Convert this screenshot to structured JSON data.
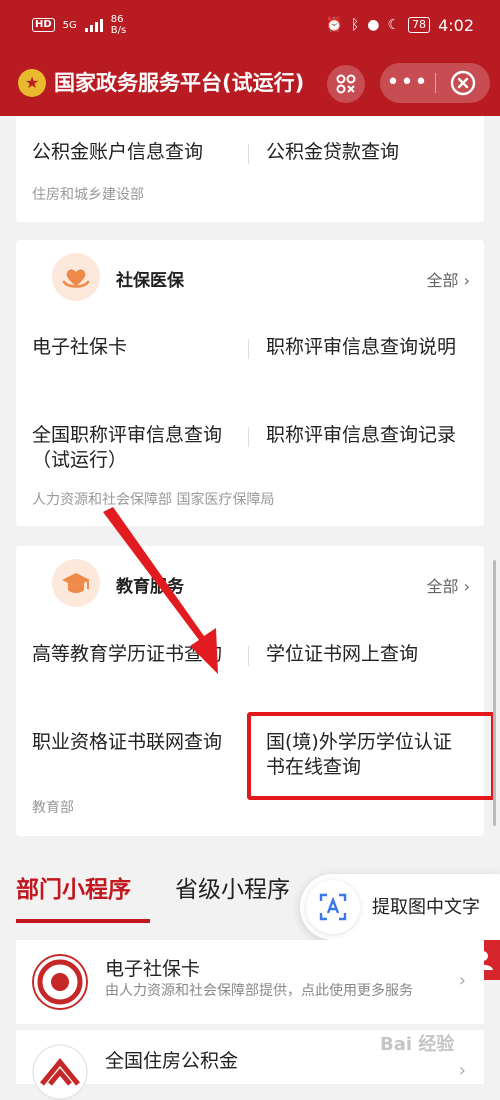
{
  "status_bar": {
    "hd": "HD",
    "net": "5G",
    "speed_value": "86",
    "speed_unit": "B/s",
    "battery": "78",
    "time": "4:02"
  },
  "header": {
    "title": "国家政务服务平台(试运行)",
    "more_icon": "ellipsis-icon",
    "close_icon": "close-circle-icon",
    "brand_color": "#b81c22"
  },
  "card_housing": {
    "items": [
      "公积金账户信息查询",
      "公积金贷款查询"
    ],
    "department": "住房和城乡建设部"
  },
  "card_social": {
    "title": "社保医保",
    "all_label": "全部",
    "items": [
      "电子社保卡",
      "职称评审信息查询说明",
      "全国职称评审信息查询（试运行）",
      "职称评审信息查询记录"
    ],
    "department": "人力资源和社会保障部 国家医疗保障局"
  },
  "card_education": {
    "title": "教育服务",
    "all_label": "全部",
    "items": [
      "高等教育学历证书查询",
      "学位证书网上查询",
      "职业资格证书联网查询",
      "国(境)外学历学位认证书在线查询"
    ],
    "department": "教育部"
  },
  "tabs": {
    "active": "部门小程序",
    "inactive": "省级小程序"
  },
  "ocr": {
    "label": "提取图中文字"
  },
  "list": [
    {
      "title": "电子社保卡",
      "desc": "由人力资源和社会保障部提供，点此使用更多服务"
    },
    {
      "title": "全国住房公积金",
      "desc": ""
    }
  ],
  "watermark": "Bai 经验",
  "accent_red": "#c0181e"
}
